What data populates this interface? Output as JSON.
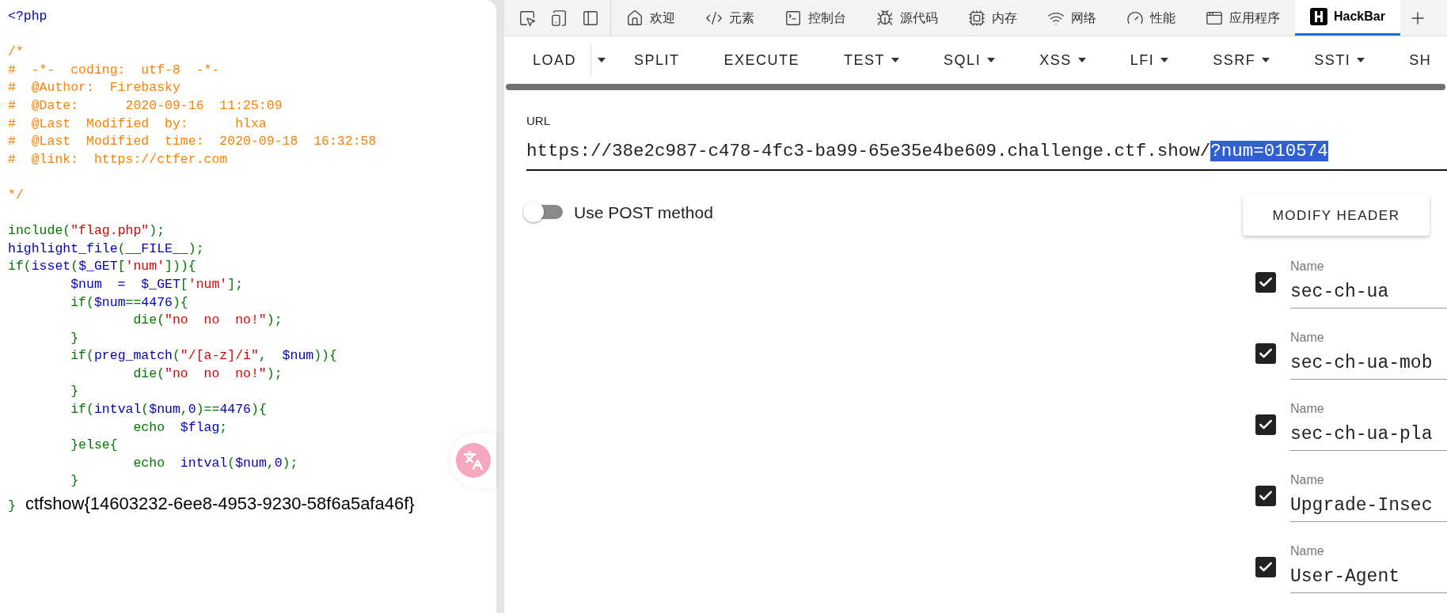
{
  "code": {
    "lines": [
      {
        "kind": "code",
        "segments": [
          {
            "text": "<?php",
            "kind": "default"
          }
        ]
      },
      {
        "kind": "blank"
      },
      {
        "kind": "code",
        "segments": [
          {
            "text": "/*",
            "kind": "comment"
          }
        ]
      },
      {
        "kind": "code",
        "segments": [
          {
            "text": "#  -*-  coding:  utf-8  -*-",
            "kind": "comment"
          }
        ]
      },
      {
        "kind": "code",
        "segments": [
          {
            "text": "#  @Author:  Firebasky",
            "kind": "comment"
          }
        ]
      },
      {
        "kind": "code",
        "segments": [
          {
            "text": "#  @Date:      2020-09-16  11:25:09",
            "kind": "comment"
          }
        ]
      },
      {
        "kind": "code",
        "segments": [
          {
            "text": "#  @Last  Modified  by:      hlxa",
            "kind": "comment"
          }
        ]
      },
      {
        "kind": "code",
        "segments": [
          {
            "text": "#  @Last  Modified  time:  2020-09-18  16:32:58",
            "kind": "comment"
          }
        ]
      },
      {
        "kind": "code",
        "segments": [
          {
            "text": "#  @link:  https://ctfer.com",
            "kind": "comment"
          }
        ]
      },
      {
        "kind": "blank"
      },
      {
        "kind": "code",
        "segments": [
          {
            "text": "*/",
            "kind": "comment"
          }
        ]
      },
      {
        "kind": "blank"
      },
      {
        "kind": "code",
        "segments": [
          {
            "text": "include(",
            "kind": "keyword"
          },
          {
            "text": "\"flag.php\"",
            "kind": "string"
          },
          {
            "text": ");",
            "kind": "keyword"
          }
        ]
      },
      {
        "kind": "code",
        "segments": [
          {
            "text": "highlight_file",
            "kind": "default"
          },
          {
            "text": "(",
            "kind": "keyword"
          },
          {
            "text": "__FILE__",
            "kind": "default"
          },
          {
            "text": ");",
            "kind": "keyword"
          }
        ]
      },
      {
        "kind": "code",
        "segments": [
          {
            "text": "if(",
            "kind": "keyword"
          },
          {
            "text": "isset",
            "kind": "default"
          },
          {
            "text": "(",
            "kind": "keyword"
          },
          {
            "text": "$_GET",
            "kind": "default"
          },
          {
            "text": "[",
            "kind": "keyword"
          },
          {
            "text": "'num'",
            "kind": "string"
          },
          {
            "text": "])){",
            "kind": "keyword"
          }
        ]
      },
      {
        "kind": "code",
        "segments": [
          {
            "text": "        $num  =  $_GET",
            "kind": "default"
          },
          {
            "text": "[",
            "kind": "keyword"
          },
          {
            "text": "'num'",
            "kind": "string"
          },
          {
            "text": "];",
            "kind": "keyword"
          }
        ]
      },
      {
        "kind": "code",
        "segments": [
          {
            "text": "        if(",
            "kind": "keyword"
          },
          {
            "text": "$num",
            "kind": "default"
          },
          {
            "text": "==",
            "kind": "keyword"
          },
          {
            "text": "4476",
            "kind": "default"
          },
          {
            "text": "){",
            "kind": "keyword"
          }
        ]
      },
      {
        "kind": "code",
        "segments": [
          {
            "text": "                die(",
            "kind": "keyword"
          },
          {
            "text": "\"no  no  no!\"",
            "kind": "string"
          },
          {
            "text": ");",
            "kind": "keyword"
          }
        ]
      },
      {
        "kind": "code",
        "segments": [
          {
            "text": "        }",
            "kind": "keyword"
          }
        ]
      },
      {
        "kind": "code",
        "segments": [
          {
            "text": "        if(",
            "kind": "keyword"
          },
          {
            "text": "preg_match",
            "kind": "default"
          },
          {
            "text": "(",
            "kind": "keyword"
          },
          {
            "text": "\"/[a-z]/i\"",
            "kind": "string"
          },
          {
            "text": ",  ",
            "kind": "keyword"
          },
          {
            "text": "$num",
            "kind": "default"
          },
          {
            "text": ")){",
            "kind": "keyword"
          }
        ]
      },
      {
        "kind": "code",
        "segments": [
          {
            "text": "                die(",
            "kind": "keyword"
          },
          {
            "text": "\"no  no  no!\"",
            "kind": "string"
          },
          {
            "text": ");",
            "kind": "keyword"
          }
        ]
      },
      {
        "kind": "code",
        "segments": [
          {
            "text": "        }",
            "kind": "keyword"
          }
        ]
      },
      {
        "kind": "code",
        "segments": [
          {
            "text": "        if(",
            "kind": "keyword"
          },
          {
            "text": "intval",
            "kind": "default"
          },
          {
            "text": "(",
            "kind": "keyword"
          },
          {
            "text": "$num",
            "kind": "default"
          },
          {
            "text": ",",
            "kind": "keyword"
          },
          {
            "text": "0",
            "kind": "default"
          },
          {
            "text": ")==",
            "kind": "keyword"
          },
          {
            "text": "4476",
            "kind": "default"
          },
          {
            "text": "){",
            "kind": "keyword"
          }
        ]
      },
      {
        "kind": "code",
        "segments": [
          {
            "text": "                echo  ",
            "kind": "keyword"
          },
          {
            "text": "$flag",
            "kind": "default"
          },
          {
            "text": ";",
            "kind": "keyword"
          }
        ]
      },
      {
        "kind": "code",
        "segments": [
          {
            "text": "        }else{",
            "kind": "keyword"
          }
        ]
      },
      {
        "kind": "code",
        "segments": [
          {
            "text": "                echo  ",
            "kind": "keyword"
          },
          {
            "text": "intval",
            "kind": "default"
          },
          {
            "text": "(",
            "kind": "keyword"
          },
          {
            "text": "$num",
            "kind": "default"
          },
          {
            "text": ",",
            "kind": "keyword"
          },
          {
            "text": "0",
            "kind": "default"
          },
          {
            "text": ");",
            "kind": "keyword"
          }
        ]
      },
      {
        "kind": "code",
        "segments": [
          {
            "text": "        }",
            "kind": "keyword"
          }
        ]
      }
    ],
    "closing": "}",
    "output": "ctfshow{14603232-6ee8-4953-9230-58f6a5afa46f}"
  },
  "devtools": {
    "tabs": [
      {
        "label": "欢迎",
        "selected": false
      },
      {
        "label": "元素",
        "selected": false
      },
      {
        "label": "控制台",
        "selected": false
      },
      {
        "label": "源代码",
        "selected": false
      },
      {
        "label": "内存",
        "selected": false
      },
      {
        "label": "网络",
        "selected": false
      },
      {
        "label": "性能",
        "selected": false
      },
      {
        "label": "应用程序",
        "selected": false
      },
      {
        "label": "HackBar",
        "selected": true
      }
    ]
  },
  "hackbar": {
    "toolbar": [
      {
        "label": "LOAD",
        "kind": "split"
      },
      {
        "label": "SPLIT",
        "kind": "plain"
      },
      {
        "label": "EXECUTE",
        "kind": "plain"
      },
      {
        "label": "TEST",
        "kind": "menu"
      },
      {
        "label": "SQLI",
        "kind": "menu"
      },
      {
        "label": "XSS",
        "kind": "menu"
      },
      {
        "label": "LFI",
        "kind": "menu"
      },
      {
        "label": "SSRF",
        "kind": "menu"
      },
      {
        "label": "SSTI",
        "kind": "menu"
      },
      {
        "label": "SH",
        "kind": "plain"
      }
    ],
    "url": {
      "label": "URL",
      "segments": [
        {
          "text": "https://38e2c987-c478-4fc3-ba99-65e35e4be609.challenge.ctf.show/",
          "selected": false
        },
        {
          "text": "?num=010574",
          "selected": true
        }
      ]
    },
    "post_toggle": {
      "label": "Use POST method",
      "on": false
    },
    "modify_header_button": "MODIFY HEADER",
    "headers": [
      {
        "field_label": "Name",
        "value": "sec-ch-ua",
        "checked": true
      },
      {
        "field_label": "Name",
        "value": "sec-ch-ua-mob",
        "checked": true
      },
      {
        "field_label": "Name",
        "value": "sec-ch-ua-pla",
        "checked": true
      },
      {
        "field_label": "Name",
        "value": "Upgrade-Insec",
        "checked": true
      },
      {
        "field_label": "Name",
        "value": "User-Agent",
        "checked": true
      }
    ]
  }
}
